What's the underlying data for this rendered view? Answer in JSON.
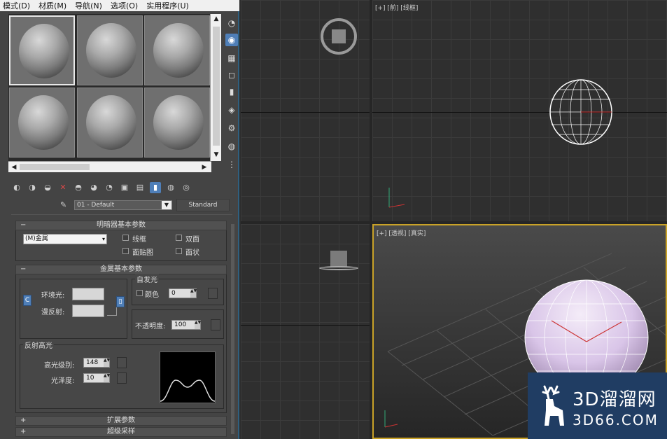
{
  "material_editor": {
    "menu": [
      "模式(D)",
      "材质(M)",
      "导航(N)",
      "选项(O)",
      "实用程序(U)"
    ],
    "material_name": "01 - Default",
    "material_type_button": "Standard",
    "shader_rollout": {
      "title": "明暗器基本参数",
      "shader": "(M)金属",
      "options": [
        "线框",
        "双面",
        "面贴图",
        "面状"
      ]
    },
    "metal_rollout": {
      "title": "金属基本参数",
      "ambient_label": "环境光:",
      "diffuse_label": "漫反射:",
      "self_illum": {
        "title": "自发光",
        "color_label": "颜色",
        "value": "0"
      },
      "opacity_label": "不透明度:",
      "opacity_value": "100",
      "specular": {
        "title": "反射高光",
        "level_label": "高光级别:",
        "level_value": "148",
        "gloss_label": "光泽度:",
        "gloss_value": "10"
      }
    },
    "collapsed_rollouts": [
      "扩展参数",
      "超级采样"
    ]
  },
  "viewports": {
    "top_right_label": "[+] [前] [线框]",
    "bottom_right_label": "[+] [透视] [真实]"
  },
  "watermark": {
    "brand": "3D溜溜网",
    "domain": "3D66.COM"
  },
  "colors": {
    "accent": "#4f7fb8",
    "active_viewport_border": "#c9a227",
    "watermark_bg": "#203d63",
    "sphere_tint": "#d9c5e8"
  }
}
